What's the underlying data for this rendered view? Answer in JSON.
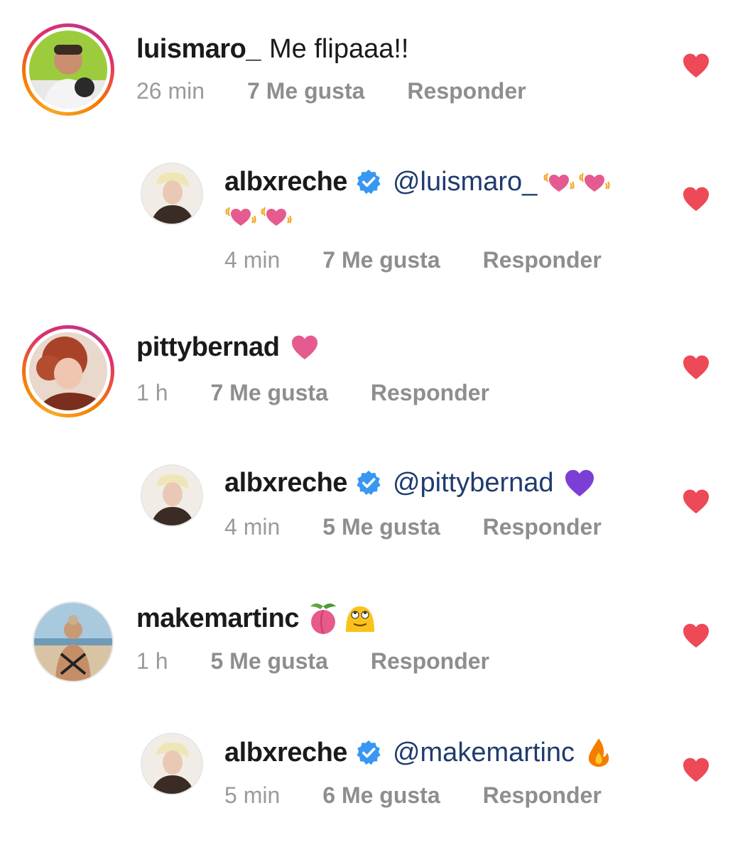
{
  "colors": {
    "heart": "#ed4956",
    "mention": "#1f3b6f",
    "meta": "#8e8e8e",
    "verified": "#3897f0"
  },
  "comments": [
    {
      "username": "luismaro_",
      "text": "Me flipaaa!!",
      "time": "26 min",
      "likes": "7 Me gusta",
      "reply_label": "Responder",
      "story_ring": true,
      "emojis": []
    },
    {
      "username": "albxreche",
      "verified": true,
      "mention": "@luismaro_",
      "time": "4 min",
      "likes": "7 Me gusta",
      "reply_label": "Responder",
      "emojis": [
        "vibrating-heart-emoji",
        "vibrating-heart-emoji",
        "vibrating-heart-emoji",
        "vibrating-heart-emoji"
      ]
    },
    {
      "username": "pittybernad",
      "time": "1 h",
      "likes": "7 Me gusta",
      "reply_label": "Responder",
      "story_ring": true,
      "emojis": [
        "pink-heart-emoji"
      ]
    },
    {
      "username": "albxreche",
      "verified": true,
      "mention": "@pittybernad",
      "time": "4 min",
      "likes": "5 Me gusta",
      "reply_label": "Responder",
      "emojis": [
        "purple-heart-emoji"
      ]
    },
    {
      "username": "makemartinc",
      "time": "1 h",
      "likes": "5 Me gusta",
      "reply_label": "Responder",
      "story_ring": false,
      "emojis": [
        "peach-emoji",
        "eye-roll-emoji"
      ]
    },
    {
      "username": "albxreche",
      "verified": true,
      "mention": "@makemartinc",
      "time": "5 min",
      "likes": "6 Me gusta",
      "reply_label": "Responder",
      "emojis": [
        "fire-emoji"
      ]
    }
  ]
}
